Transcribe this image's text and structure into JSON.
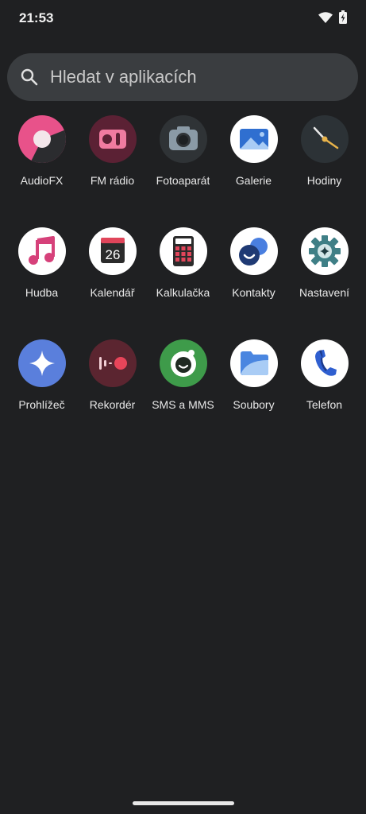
{
  "status_bar": {
    "time": "21:53"
  },
  "search": {
    "placeholder": "Hledat v aplikacích"
  },
  "apps": [
    {
      "label": "AudioFX",
      "icon": "audiofx-icon"
    },
    {
      "label": "FM rádio",
      "icon": "fm-radio-icon"
    },
    {
      "label": "Fotoaparát",
      "icon": "camera-icon"
    },
    {
      "label": "Galerie",
      "icon": "gallery-icon"
    },
    {
      "label": "Hodiny",
      "icon": "clock-icon"
    },
    {
      "label": "Hudba",
      "icon": "music-icon"
    },
    {
      "label": "Kalendář",
      "icon": "calendar-icon",
      "text": "26"
    },
    {
      "label": "Kalkulačka",
      "icon": "calculator-icon"
    },
    {
      "label": "Kontakty",
      "icon": "contacts-icon"
    },
    {
      "label": "Nastavení",
      "icon": "settings-gear-icon"
    },
    {
      "label": "Prohlížeč",
      "icon": "browser-icon"
    },
    {
      "label": "Rekordér",
      "icon": "recorder-icon"
    },
    {
      "label": "SMS a MMS",
      "icon": "messaging-icon"
    },
    {
      "label": "Soubory",
      "icon": "files-folder-icon"
    },
    {
      "label": "Telefon",
      "icon": "phone-icon"
    }
  ],
  "colors": {
    "background": "#1f2022",
    "search_bg": "#3a3d40",
    "audiofx_pink": "#e8528a",
    "fm_maroon": "#5b2134",
    "browser_blue": "#5a7fdc",
    "recorder_red": "#e8455a",
    "sms_green": "#3e9b4a"
  }
}
